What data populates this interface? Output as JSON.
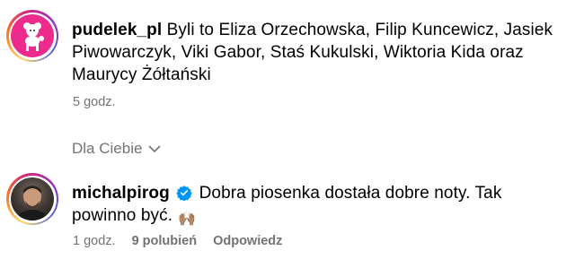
{
  "comments": [
    {
      "username": "pudelek_pl",
      "text": "Byli to Eliza Orzechowska, Filip Kuncewicz, Jasiek Piwowarczyk, Viki Gabor, Staś Kukulski, Wiktoria Kida oraz Maurycy Żółtański",
      "time": "5 godz."
    },
    {
      "username": "michalpirog",
      "verified": true,
      "text": "Dobra piosenka dostała dobre noty. Tak powinno być.",
      "emoji": "🙌🏽",
      "time": "1 godz.",
      "likes": "9 polubień",
      "reply_label": "Odpowiedz"
    }
  ],
  "section": {
    "label": "Dla Ciebie",
    "icon": "chevron-down-icon"
  },
  "colors": {
    "muted": "#737373",
    "verified": "#0095f6",
    "pudelek_brand": "#ec2b8c"
  }
}
